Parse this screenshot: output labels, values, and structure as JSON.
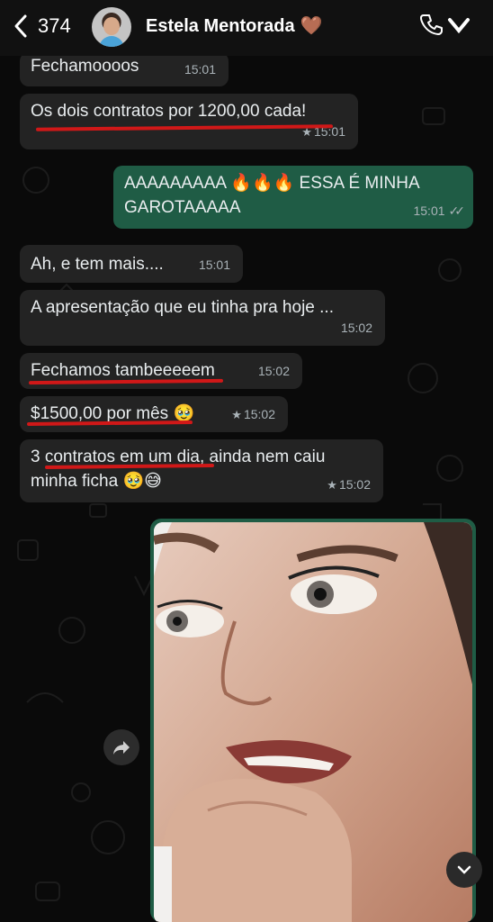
{
  "header": {
    "back_count": "374",
    "contact_name": "Estela Mentorada",
    "contact_emoji": "🤎"
  },
  "messages": [
    {
      "text": "Fechamoooos",
      "time": "15:01",
      "starred": false
    },
    {
      "text": "Os dois contratos por 1200,00 cada!",
      "time": "15:01",
      "starred": true
    },
    {
      "text": "AAAAAAAAA 🔥🔥🔥 ESSA É MINHA GAROTAAAAA",
      "time": "15:01",
      "starred": false
    },
    {
      "text": "Ah, e tem mais....",
      "time": "15:01",
      "starred": false
    },
    {
      "text": "A apresentação que eu tinha pra hoje ...",
      "time": "15:02",
      "starred": false
    },
    {
      "text": "Fechamos tambeeeeem",
      "time": "15:02",
      "starred": false
    },
    {
      "text": "$1500,00 por mês 🥹",
      "time": "15:02",
      "starred": true
    },
    {
      "text": "3 contratos em um dia, ainda nem caiu minha ficha 🥹😅",
      "time": "15:02",
      "starred": true
    }
  ],
  "icons": {
    "star": "★",
    "read_ticks": "✓✓"
  },
  "colors": {
    "incoming_bubble": "#232323",
    "outgoing_bubble": "#1f5c45",
    "underline": "#d01818"
  }
}
